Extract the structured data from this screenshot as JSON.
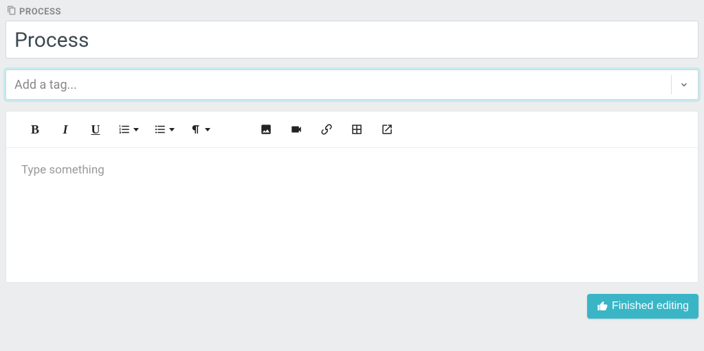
{
  "section": {
    "label": "PROCESS"
  },
  "title": {
    "value": "Process"
  },
  "tags": {
    "placeholder": "Add a tag..."
  },
  "editor": {
    "placeholder": "Type something"
  },
  "footer": {
    "finish_label": "Finished editing"
  }
}
